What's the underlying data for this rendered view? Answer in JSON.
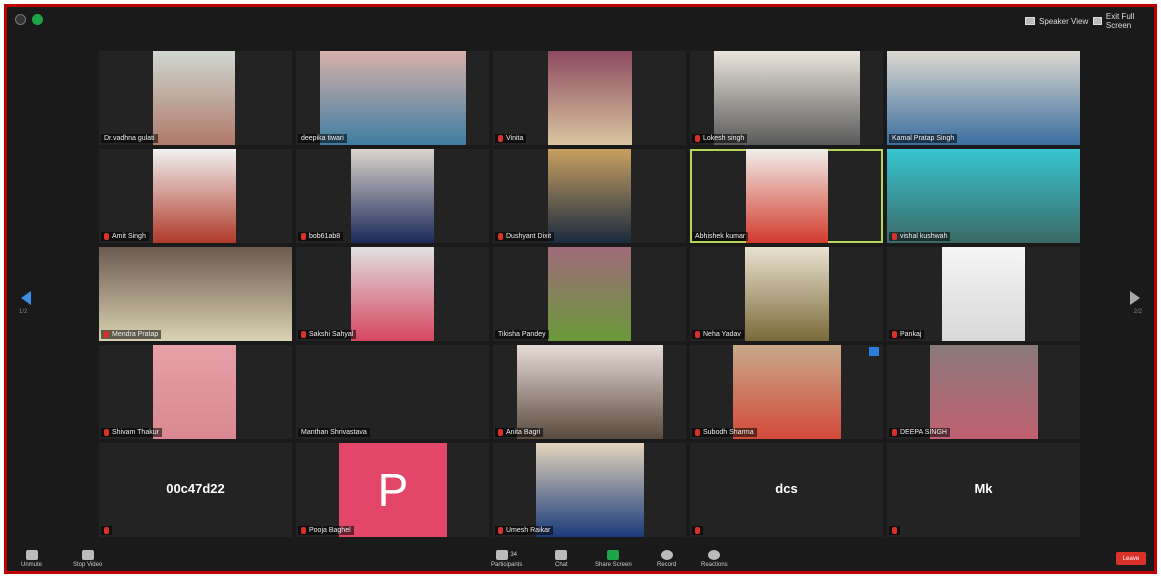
{
  "top": {
    "speaker_view": "Speaker View",
    "exit_fullscreen": "Exit Full Screen"
  },
  "nav": {
    "prev_page": "1/2",
    "next_page": "2/2"
  },
  "participants": [
    {
      "name": "Dr.vadhna gulati"
    },
    {
      "name": "deepika tiwari"
    },
    {
      "name": "Vinita"
    },
    {
      "name": "Lokesh singh"
    },
    {
      "name": "Kamal Pratap Singh"
    },
    {
      "name": "Amit Singh"
    },
    {
      "name": "bob61ab8"
    },
    {
      "name": "Dushyant Dixit"
    },
    {
      "name": "Abhishek kumar"
    },
    {
      "name": "vishal kushwah"
    },
    {
      "name": "Mendra Pratap"
    },
    {
      "name": "Sakshi Sahyal"
    },
    {
      "name": "Tikisha Pandey"
    },
    {
      "name": "Neha Yadav"
    },
    {
      "name": "Pankaj"
    },
    {
      "name": "Shivam Thakur"
    },
    {
      "name": "Manthan Shrivastava"
    },
    {
      "name": "Anita Bagri"
    },
    {
      "name": "Subodh Sharma"
    },
    {
      "name": "DEEPA SINGH"
    },
    {
      "name": "",
      "display_name": "00c47d22"
    },
    {
      "name": "Pooja Baghel",
      "avatar_letter": "P"
    },
    {
      "name": "Umesh Raikar"
    },
    {
      "name": "",
      "display_name": "dcs"
    },
    {
      "name": "",
      "display_name": "Mk"
    }
  ],
  "toolbar": {
    "unmute": "Unmute",
    "stop_video": "Stop Video",
    "participants": "Participants",
    "participants_count": "34",
    "chat": "Chat",
    "share_screen": "Share Screen",
    "record": "Record",
    "reactions": "Reactions",
    "leave": "Leave"
  }
}
